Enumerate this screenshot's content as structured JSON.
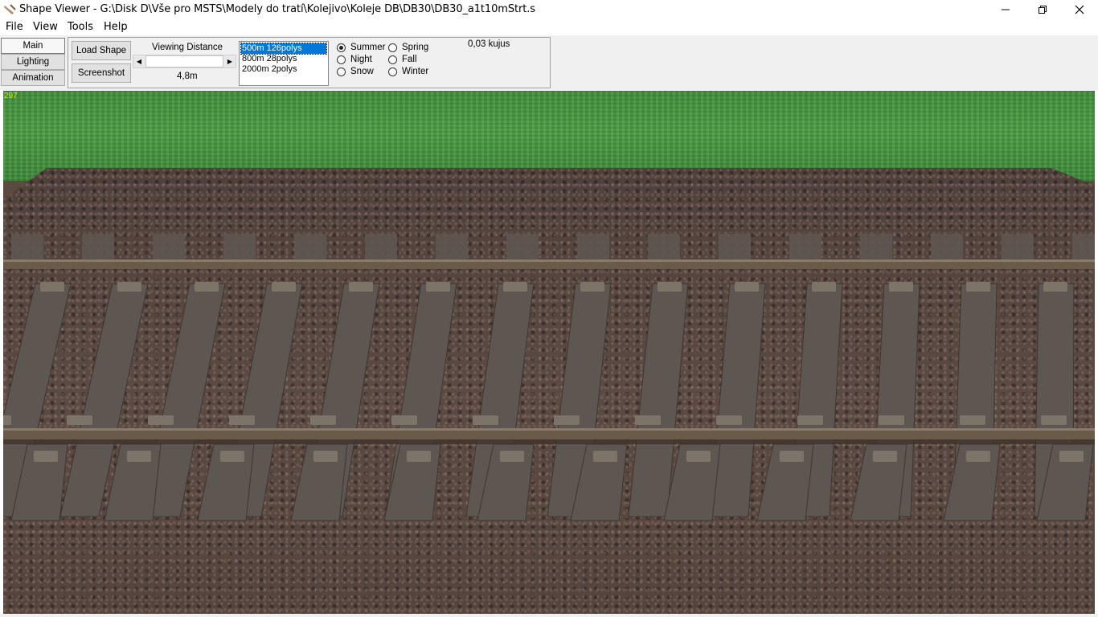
{
  "window": {
    "title": "Shape Viewer - G:\\Disk D\\Vše pro MSTS\\Modely do tratí\\Kolejivo\\Koleje DB\\DB30\\DB30_a1t10mStrt.s"
  },
  "menu": [
    "File",
    "View",
    "Tools",
    "Help"
  ],
  "side_tabs": [
    "Main",
    "Lighting",
    "Animation"
  ],
  "panel": {
    "load_shape_label": "Load Shape",
    "screenshot_label": "Screenshot",
    "viewing_distance_label": "Viewing Distance",
    "viewing_distance_value": "4,8m",
    "lod_items": [
      "500m 126polys",
      "800m 28polys",
      "2000m 2polys"
    ],
    "lod_selected": "500m 126polys",
    "seasons_left": [
      "Summer",
      "Night",
      "Snow"
    ],
    "seasons_right": [
      "Spring",
      "Fall",
      "Winter"
    ],
    "season_selected": "Summer",
    "kujus": "0,03 kujus"
  },
  "viewport": {
    "fps": "297",
    "colors": {
      "grass": "#4a9c42",
      "ballast": "#5b4a43",
      "sleeper": "#5e5650",
      "rail": "#6a5a4a"
    }
  }
}
